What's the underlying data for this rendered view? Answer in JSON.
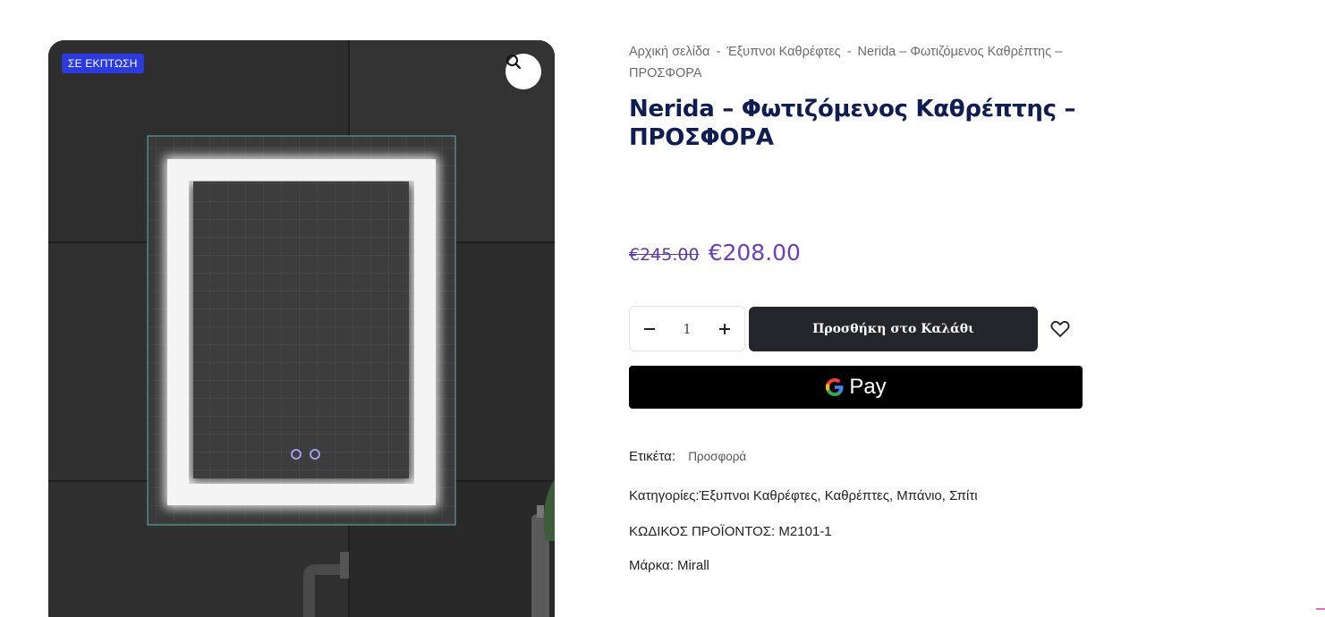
{
  "gallery": {
    "badge": "ΣΕ ΕΚΠΤΩΣΗ",
    "zoom_icon": "search-icon"
  },
  "breadcrumb": {
    "items": [
      "Αρχική σελίδα",
      "Έξυπνοι Καθρέφτες",
      "Nerida – Φωτιζόμενος Καθρέπτης – ΠΡΟΣΦΟΡΑ"
    ],
    "separator": "-"
  },
  "product": {
    "title": "Nerida – Φωτιζόμενος Καθρέπτης – ΠΡΟΣΦΟΡΑ",
    "price_old": "€245.00",
    "price_new": "€208.00",
    "quantity": "1",
    "add_to_cart_label": "Προσθήκη στο Καλάθι",
    "gpay_label": "Pay"
  },
  "meta": {
    "tag_label": "Ετικέτα:",
    "tag_value": "Προσφορά",
    "categories_label": "Κατηγορίες:",
    "categories": [
      "Έξυπνοι Καθρέφτες",
      "Καθρέπτες",
      "Μπάνιο",
      "Σπίτι"
    ],
    "sku_label": "ΚΩΔΙΚΟΣ ΠΡΟΪΟΝΤΟΣ:",
    "sku_value": "M2101-1",
    "brand_label": "Μάρκα:",
    "brand_value": "Mirall"
  },
  "colors": {
    "title": "#101d52",
    "price": "#6a3fc2",
    "badge": "#2c3be0",
    "button": "#23262b"
  }
}
